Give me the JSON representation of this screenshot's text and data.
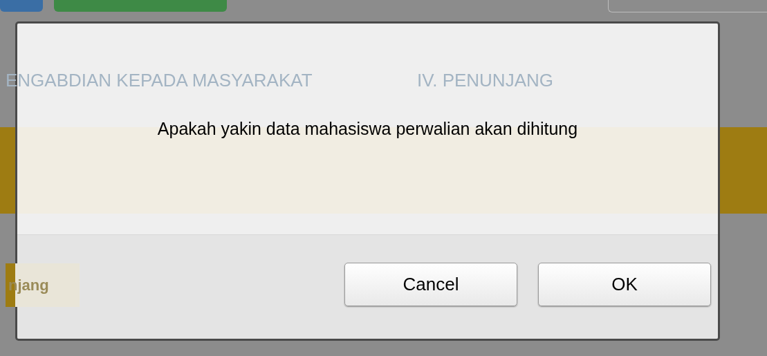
{
  "background": {
    "tabs": [
      {
        "label": "ENGABDIAN KEPADA MASYARAKAT"
      },
      {
        "label": "IV. PENUNJANG"
      }
    ],
    "section_button": "njang"
  },
  "dialog": {
    "message": "Apakah yakin data mahasiswa perwalian akan dihitung",
    "buttons": [
      {
        "label": "Cancel"
      },
      {
        "label": "OK"
      }
    ]
  }
}
